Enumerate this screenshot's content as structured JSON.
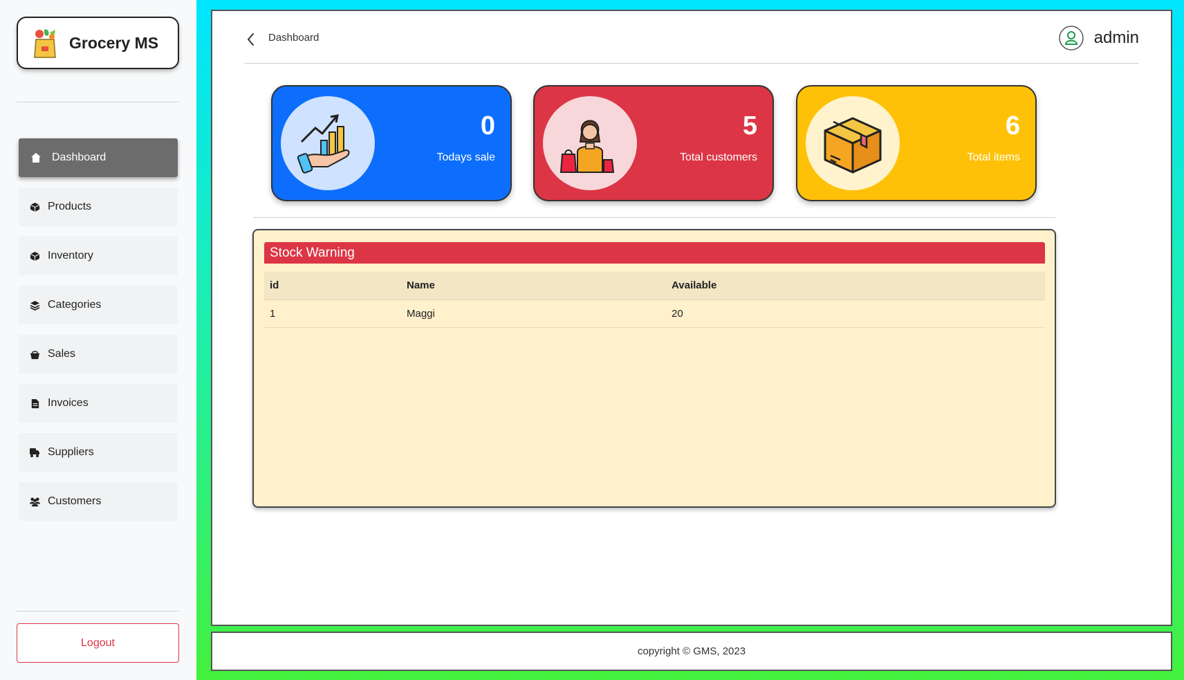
{
  "brand": {
    "name": "Grocery MS",
    "logo_icon": "grocery-bag-icon"
  },
  "sidebar": {
    "items": [
      {
        "label": "Dashboard",
        "icon": "home-icon",
        "active": true
      },
      {
        "label": "Products",
        "icon": "cube-icon"
      },
      {
        "label": "Inventory",
        "icon": "cube-icon"
      },
      {
        "label": "Categories",
        "icon": "layers-icon"
      },
      {
        "label": "Sales",
        "icon": "basket-icon"
      },
      {
        "label": "Invoices",
        "icon": "file-icon"
      },
      {
        "label": "Suppliers",
        "icon": "truck-icon"
      },
      {
        "label": "Customers",
        "icon": "users-icon"
      }
    ],
    "logout_label": "Logout"
  },
  "header": {
    "breadcrumb": "Dashboard",
    "user_name": "admin"
  },
  "stats": [
    {
      "value": "0",
      "label": "Todays sale",
      "color": "#0d6efd",
      "icon": "sales-growth-icon"
    },
    {
      "value": "5",
      "label": "Total customers",
      "color": "#dc3545",
      "icon": "shopper-icon"
    },
    {
      "value": "6",
      "label": "Total items",
      "color": "#ffc107",
      "icon": "box-icon"
    }
  ],
  "stock_warning": {
    "title": "Stock Warning",
    "columns": [
      "id",
      "Name",
      "Available"
    ],
    "rows": [
      [
        "1",
        "Maggi",
        "20"
      ]
    ]
  },
  "footer": {
    "text": "copyright © GMS, 2023"
  }
}
